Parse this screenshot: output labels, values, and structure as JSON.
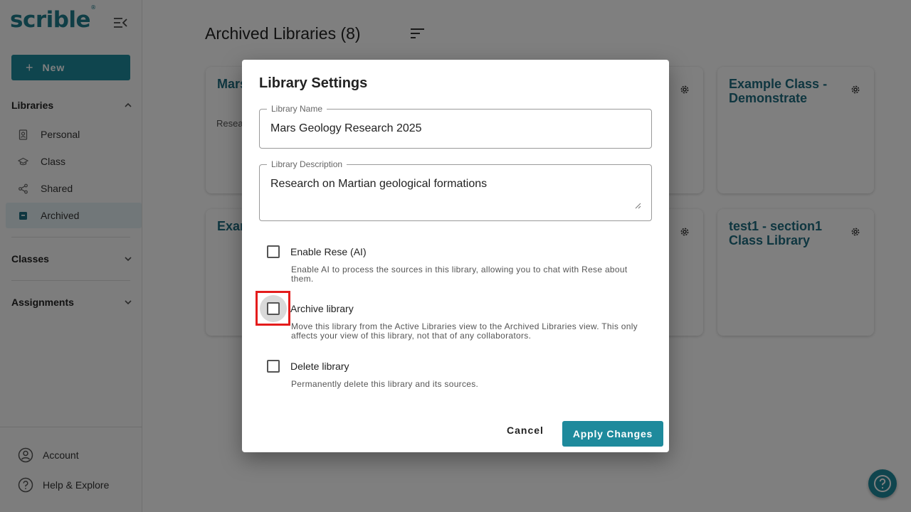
{
  "sidebar": {
    "logo": "scrible",
    "logo_mark": "®",
    "new_label": "New",
    "libraries_heading": "Libraries",
    "items": [
      {
        "label": "Personal",
        "icon": "contact-badge-icon"
      },
      {
        "label": "Class",
        "icon": "graduation-cap-icon"
      },
      {
        "label": "Shared",
        "icon": "share-icon"
      },
      {
        "label": "Archived",
        "icon": "archive-box-icon"
      }
    ],
    "classes_heading": "Classes",
    "assignments_heading": "Assignments",
    "account_label": "Account",
    "help_label": "Help & Explore"
  },
  "main": {
    "title": "Archived Libraries (8)",
    "cards": [
      {
        "title": "Mars Rese",
        "desc": "Resea geolog"
      },
      {
        "title": "Example Class - Demonstrate",
        "desc": ""
      },
      {
        "title": "Exar Invit",
        "desc": ""
      },
      {
        "title": "test1 - section1 Class Library",
        "desc": ""
      }
    ]
  },
  "dialog": {
    "title": "Library Settings",
    "name_label": "Library Name",
    "name_value": "Mars Geology Research 2025",
    "desc_label": "Library Description",
    "desc_value": "Research on Martian geological formations",
    "options": [
      {
        "label": "Enable Rese (AI)",
        "help": "Enable AI to process the sources in this library, allowing you to chat with Rese about them.",
        "checked": false
      },
      {
        "label": "Archive library",
        "help": "Move this library from the Active Libraries view to the Archived Libraries view. This only affects your view of this library, not that of any collaborators.",
        "checked": false
      },
      {
        "label": "Delete library",
        "help": "Permanently delete this library and its sources.",
        "checked": false
      }
    ],
    "cancel_label": "Cancel",
    "apply_label": "Apply Changes"
  },
  "colors": {
    "accent": "#1e8a9c",
    "brand": "#1e7d8c",
    "card_title": "#1e6d80",
    "highlight": "#e41c1c"
  }
}
